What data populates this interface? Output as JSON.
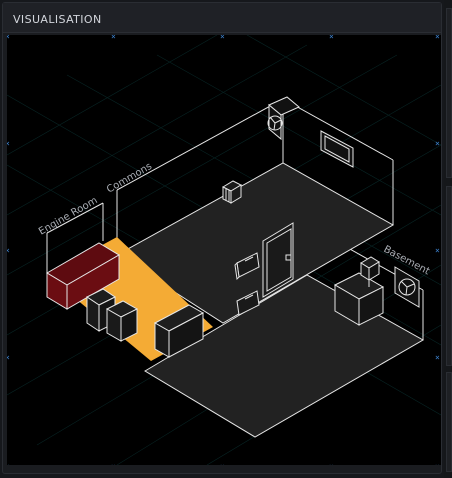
{
  "panel": {
    "title": "VISUALISATION"
  },
  "rooms": {
    "engine_room": "Engine Room",
    "commons": "Commons",
    "basement": "Basement"
  },
  "colors": {
    "background": "#000000",
    "lines": "#e8e8e8",
    "engine_floor": "#f4ab35",
    "engine_block": "#6b0d12",
    "floor": "#222222",
    "grid": "#0d3a3a",
    "marker": "#3a7ec8"
  },
  "icons": {
    "fan": "fan-icon",
    "vent": "vent-icon",
    "door": "door-icon",
    "resize_handle": "resize-handle-icon"
  }
}
